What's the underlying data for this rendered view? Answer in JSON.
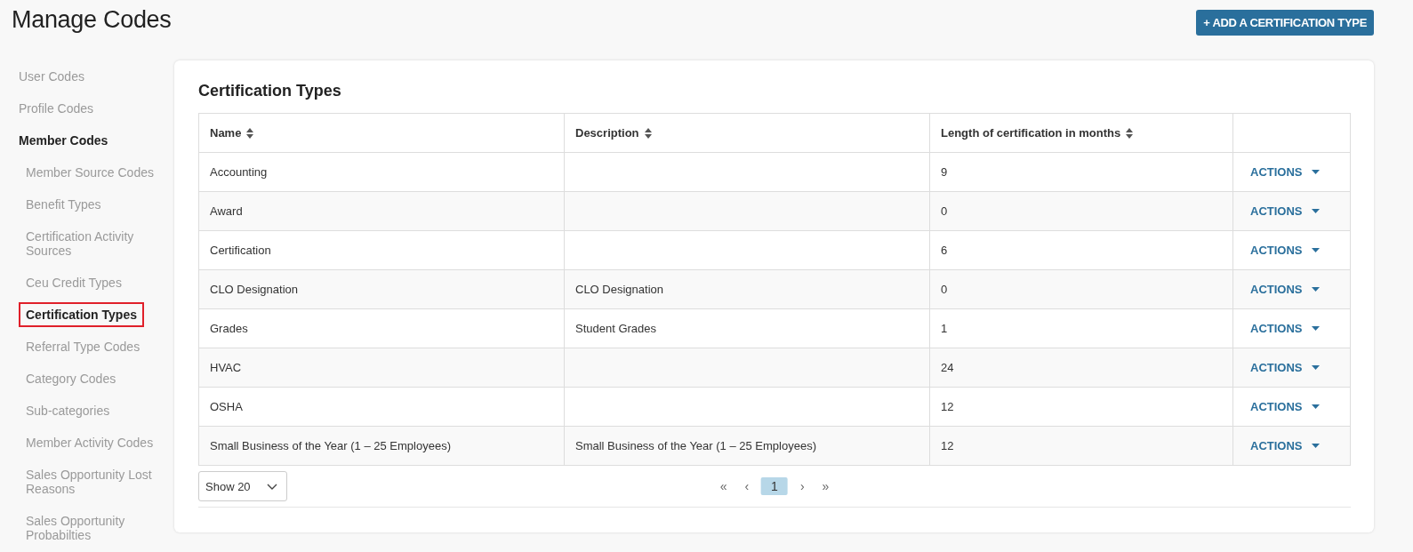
{
  "page": {
    "title": "Manage Codes",
    "add_button": "+ ADD A CERTIFICATION TYPE"
  },
  "sidebar": {
    "items": [
      {
        "label": "User Codes",
        "selected": false
      },
      {
        "label": "Profile Codes",
        "selected": false
      },
      {
        "label": "Member Codes",
        "selected": false,
        "expanded": true,
        "children": [
          {
            "label": "Member Source Codes",
            "selected": false
          },
          {
            "label": "Benefit Types",
            "selected": false
          },
          {
            "label": "Certification Activity Sources",
            "selected": false
          },
          {
            "label": "Ceu Credit Types",
            "selected": false
          },
          {
            "label": "Certification Types",
            "selected": true
          },
          {
            "label": "Referral Type Codes",
            "selected": false
          },
          {
            "label": "Category Codes",
            "selected": false
          },
          {
            "label": "Sub-categories",
            "selected": false
          },
          {
            "label": "Member Activity Codes",
            "selected": false
          },
          {
            "label": "Sales Opportunity Lost Reasons",
            "selected": false
          },
          {
            "label": "Sales Opportunity Probabilties",
            "selected": false
          }
        ]
      }
    ]
  },
  "card": {
    "title": "Certification Types",
    "table": {
      "columns": [
        {
          "label": "Name",
          "sortable": true
        },
        {
          "label": "Description",
          "sortable": true
        },
        {
          "label": "Length of certification in months",
          "sortable": true
        }
      ],
      "rows": [
        {
          "name": "Accounting",
          "description": "",
          "months": "9",
          "action": "ACTIONS"
        },
        {
          "name": "Award",
          "description": "",
          "months": "0",
          "action": "ACTIONS"
        },
        {
          "name": "Certification",
          "description": "",
          "months": "6",
          "action": "ACTIONS"
        },
        {
          "name": "CLO Designation",
          "description": "CLO Designation",
          "months": "0",
          "action": "ACTIONS"
        },
        {
          "name": "Grades",
          "description": "Student Grades",
          "months": "1",
          "action": "ACTIONS"
        },
        {
          "name": "HVAC",
          "description": "",
          "months": "24",
          "action": "ACTIONS"
        },
        {
          "name": "OSHA",
          "description": "",
          "months": "12",
          "action": "ACTIONS"
        },
        {
          "name": "Small Business of the Year (1 – 25 Employees)",
          "description": "Small Business of the Year (1 – 25 Employees)",
          "months": "12",
          "action": "ACTIONS"
        }
      ]
    },
    "page_size": "Show 20",
    "pagination": {
      "first": "«",
      "prev": "‹",
      "pages": [
        {
          "label": "1",
          "selected": true
        }
      ],
      "next": "›",
      "last": "»"
    }
  }
}
